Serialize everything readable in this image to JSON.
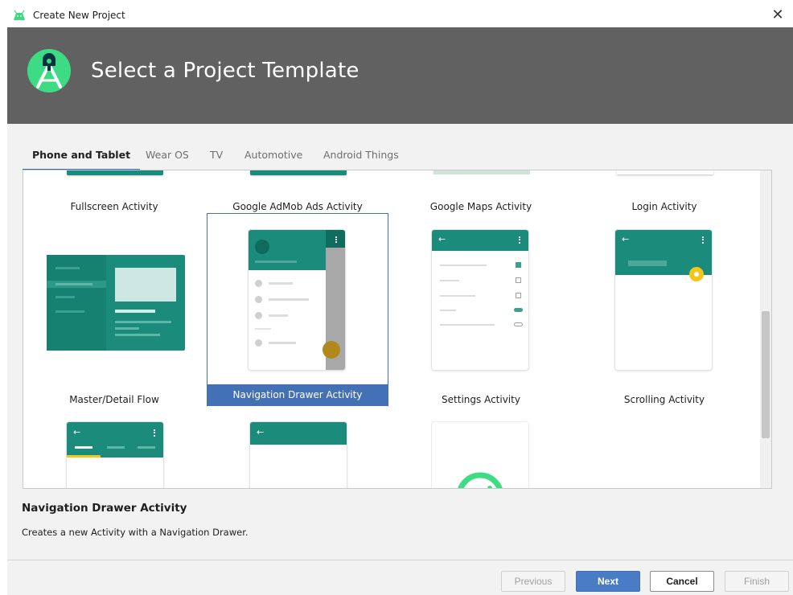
{
  "window": {
    "title": "Create New Project",
    "close_glyph": "✕"
  },
  "banner": {
    "heading": "Select a Project Template"
  },
  "tabs": [
    {
      "label": "Phone and Tablet",
      "active": true
    },
    {
      "label": "Wear OS",
      "active": false
    },
    {
      "label": "TV",
      "active": false
    },
    {
      "label": "Automotive",
      "active": false
    },
    {
      "label": "Android Things",
      "active": false
    }
  ],
  "templates": {
    "row1": [
      "Fullscreen Activity",
      "Google AdMob Ads Activity",
      "Google Maps Activity",
      "Login Activity"
    ],
    "row2": [
      "Master/Detail Flow",
      "Navigation Drawer Activity",
      "Settings Activity",
      "Scrolling Activity"
    ],
    "selected": "Navigation Drawer Activity"
  },
  "info": {
    "title": "Navigation Drawer Activity",
    "description": "Creates a new Activity with a Navigation Drawer."
  },
  "buttons": {
    "previous": "Previous",
    "next": "Next",
    "cancel": "Cancel",
    "finish": "Finish"
  },
  "colors": {
    "teal": "#1b8c7c",
    "selection": "#4470b5",
    "banner": "#616161",
    "accent": "#f5c518"
  }
}
